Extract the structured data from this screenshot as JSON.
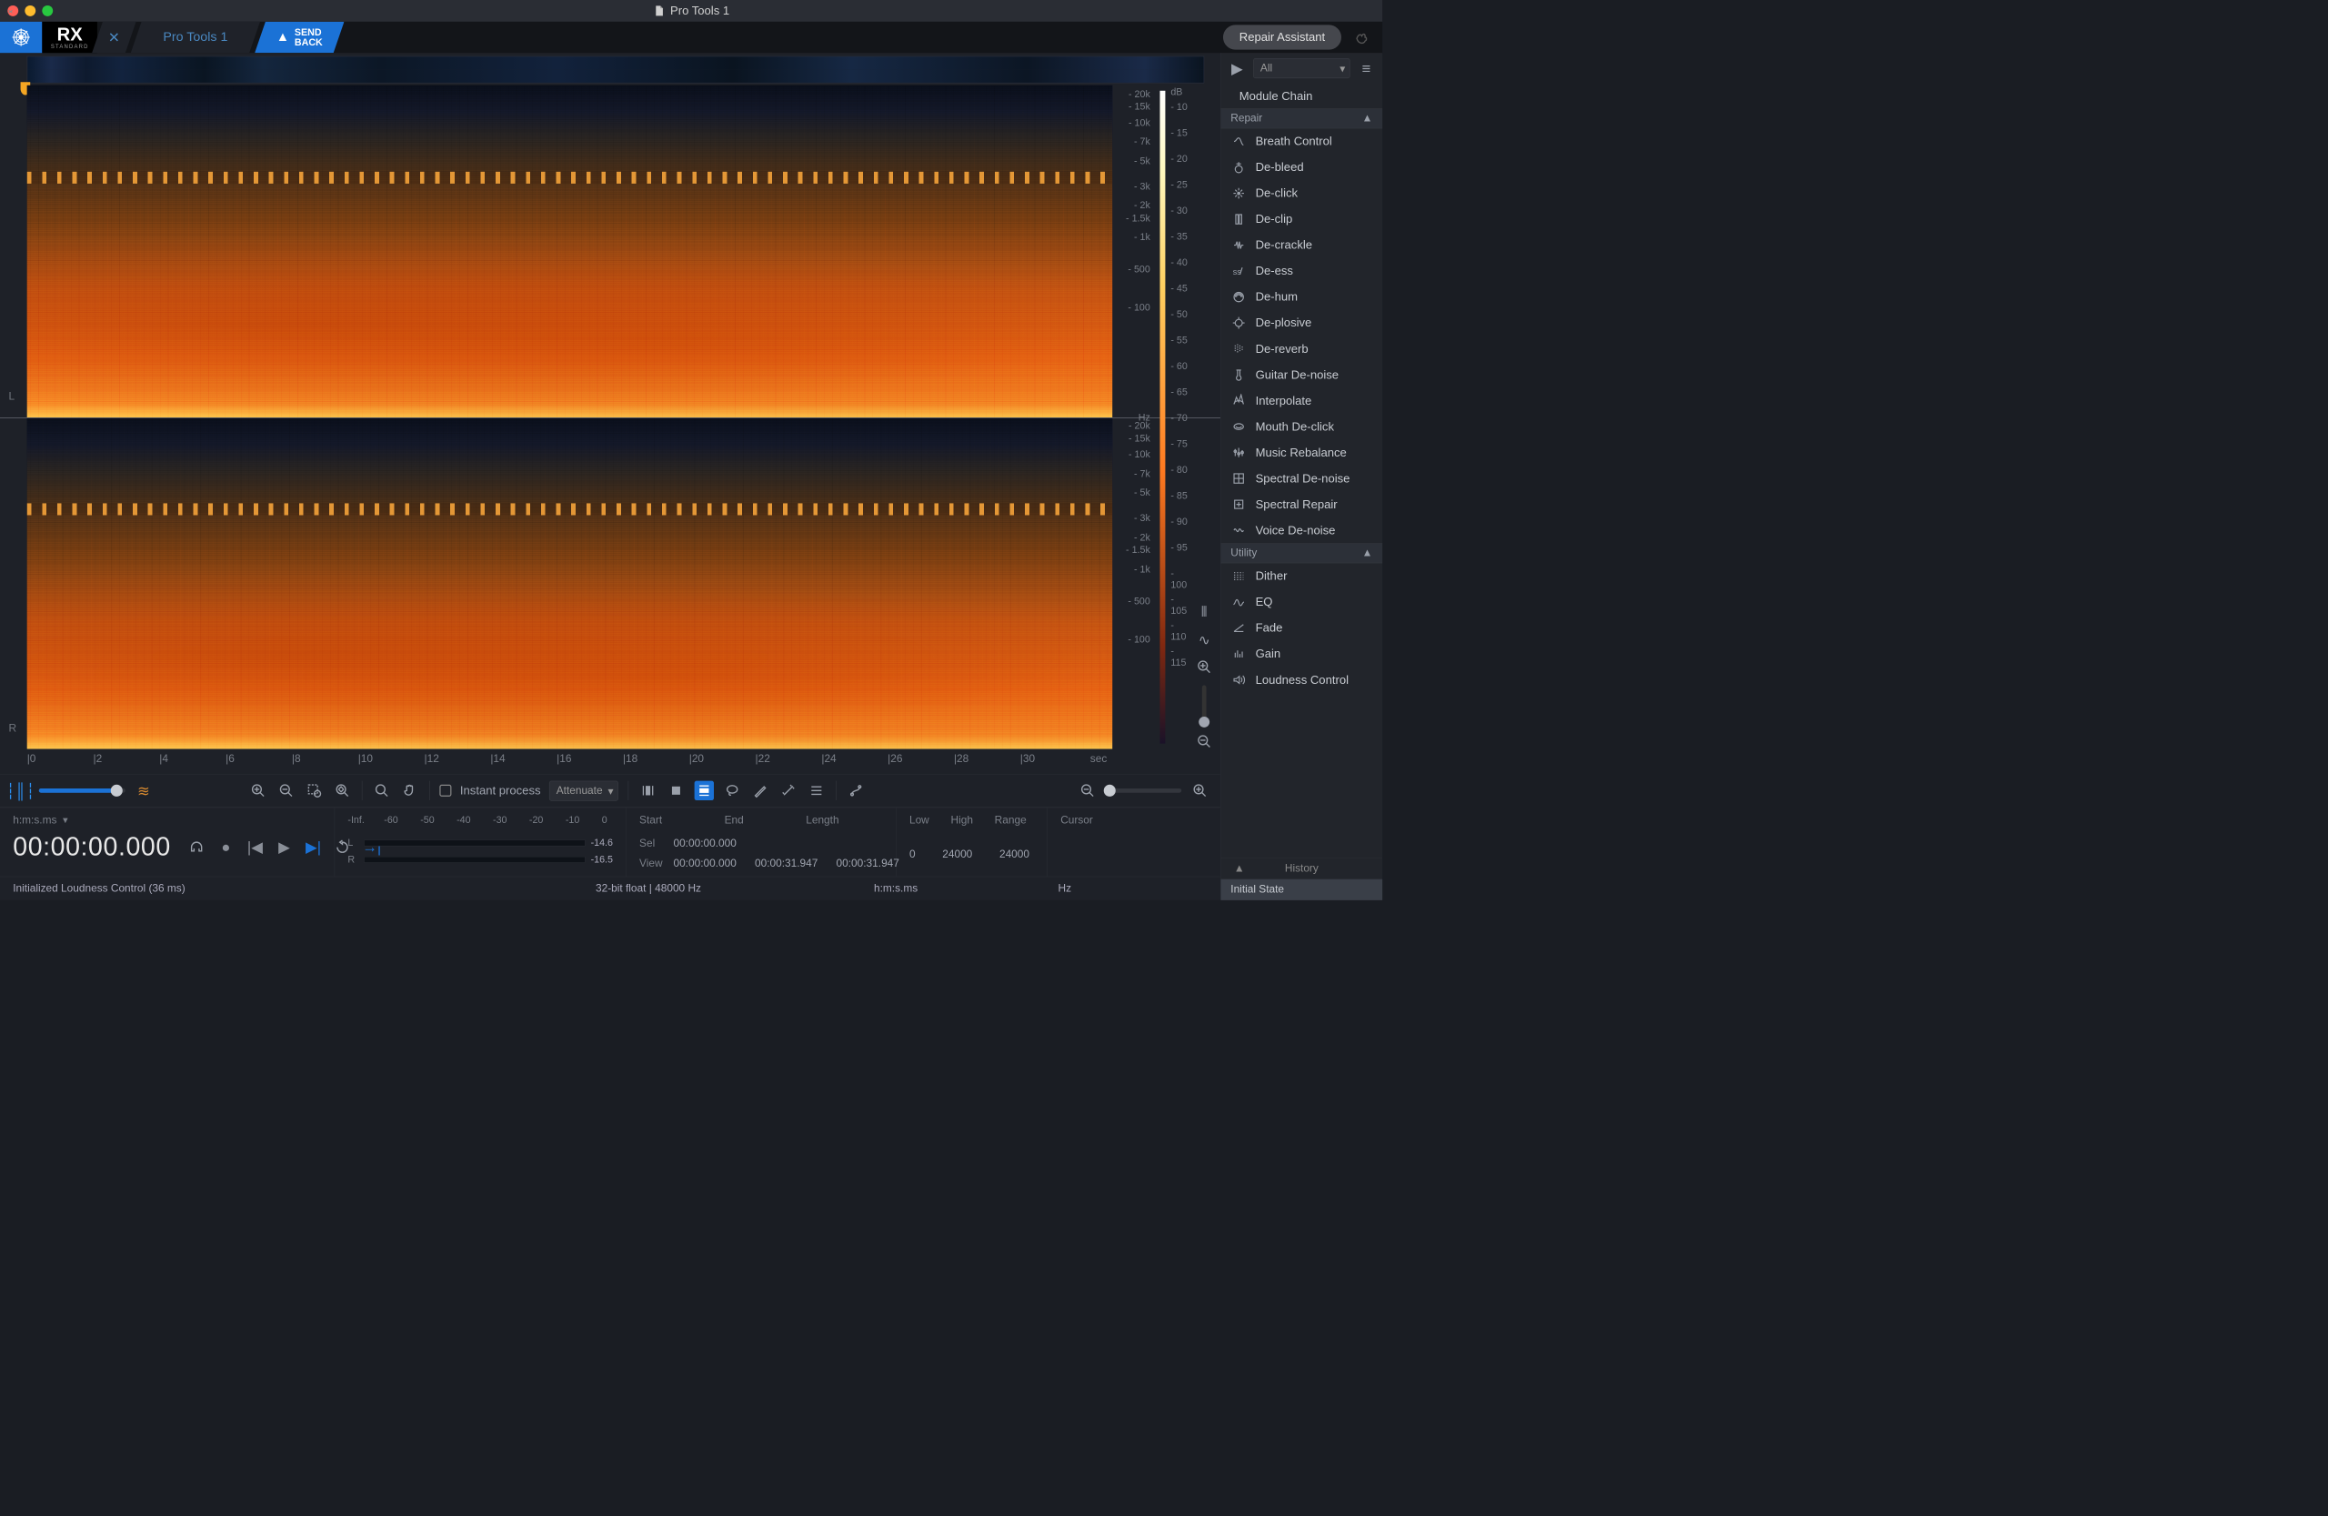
{
  "window_title": "Pro Tools 1",
  "brand": {
    "product": "RX",
    "edition": "STANDARD"
  },
  "tab_name": "Pro Tools 1",
  "send_back_label": "SEND\nBACK",
  "repair_assistant_label": "Repair Assistant",
  "module_filter": "All",
  "module_chain_label": "Module Chain",
  "sections": {
    "repair": "Repair",
    "utility": "Utility"
  },
  "modules_repair": [
    "Breath Control",
    "De-bleed",
    "De-click",
    "De-clip",
    "De-crackle",
    "De-ess",
    "De-hum",
    "De-plosive",
    "De-reverb",
    "Guitar De-noise",
    "Interpolate",
    "Mouth De-click",
    "Music Rebalance",
    "Spectral De-noise",
    "Spectral Repair",
    "Voice De-noise"
  ],
  "modules_utility": [
    "Dither",
    "EQ",
    "Fade",
    "Gain",
    "Loudness Control"
  ],
  "freq_ticks": [
    "20k",
    "15k",
    "10k",
    "7k",
    "5k",
    "3k",
    "2k",
    "1.5k",
    "1k",
    "500",
    "100"
  ],
  "freq_unit": "Hz",
  "db_header": "dB",
  "db_ticks": [
    "10",
    "15",
    "20",
    "25",
    "30",
    "35",
    "40",
    "45",
    "50",
    "55",
    "60",
    "65",
    "70",
    "75",
    "80",
    "85",
    "90",
    "95",
    "100",
    "105",
    "110",
    "115"
  ],
  "time_ticks": [
    "0",
    "2",
    "4",
    "6",
    "8",
    "10",
    "12",
    "14",
    "16",
    "18",
    "20",
    "22",
    "24",
    "26",
    "28",
    "30"
  ],
  "time_unit": "sec",
  "channels": {
    "left": "L",
    "right": "R"
  },
  "toolbar": {
    "wave_spectro_slider": 90,
    "instant_process_label": "Instant process",
    "instant_process_checked": false,
    "mode_select": "Attenuate"
  },
  "footer": {
    "time_format": "h:m:s.ms",
    "timecode": "00:00:00.000",
    "meter_ticks": [
      "-Inf.",
      "-60",
      "-50",
      "-40",
      "-30",
      "-20",
      "-10",
      "0"
    ],
    "meter_L": "-14.6",
    "meter_R": "-16.5",
    "sel_label": "Sel",
    "view_label": "View",
    "cols": {
      "start": "Start",
      "end": "End",
      "length": "Length",
      "low": "Low",
      "high": "High",
      "range": "Range",
      "cursor": "Cursor"
    },
    "sel": {
      "start": "00:00:00.000",
      "end": "",
      "length": ""
    },
    "view": {
      "start": "00:00:00.000",
      "end": "00:00:31.947",
      "length": "00:00:31.947"
    },
    "freq": {
      "low": "0",
      "high": "24000",
      "range": "24000"
    },
    "units_time": "h:m:s.ms",
    "units_freq": "Hz",
    "audio_format": "32-bit float | 48000 Hz",
    "status_msg": "Initialized Loudness Control (36 ms)"
  },
  "history": {
    "title": "History",
    "initial": "Initial State"
  }
}
